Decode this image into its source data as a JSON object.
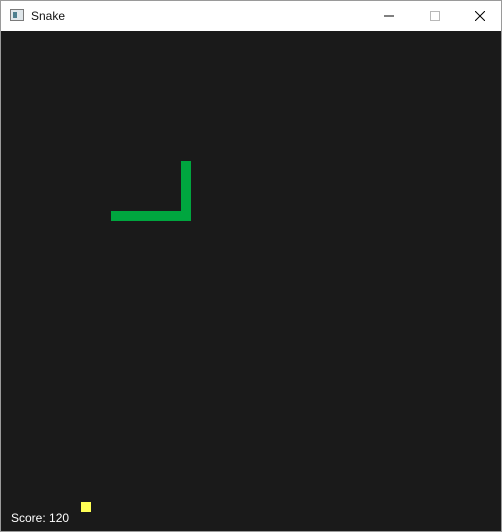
{
  "window": {
    "title": "Snake",
    "icon": "snake-app-icon",
    "controls": [
      "minimize-icon",
      "maximize-icon",
      "close-icon"
    ]
  },
  "game": {
    "score_text": "Score: 120",
    "colors": {
      "background": "#1a1a1a",
      "snake": "#00a63f",
      "food": "#ffff55",
      "text": "#ffffff"
    }
  }
}
